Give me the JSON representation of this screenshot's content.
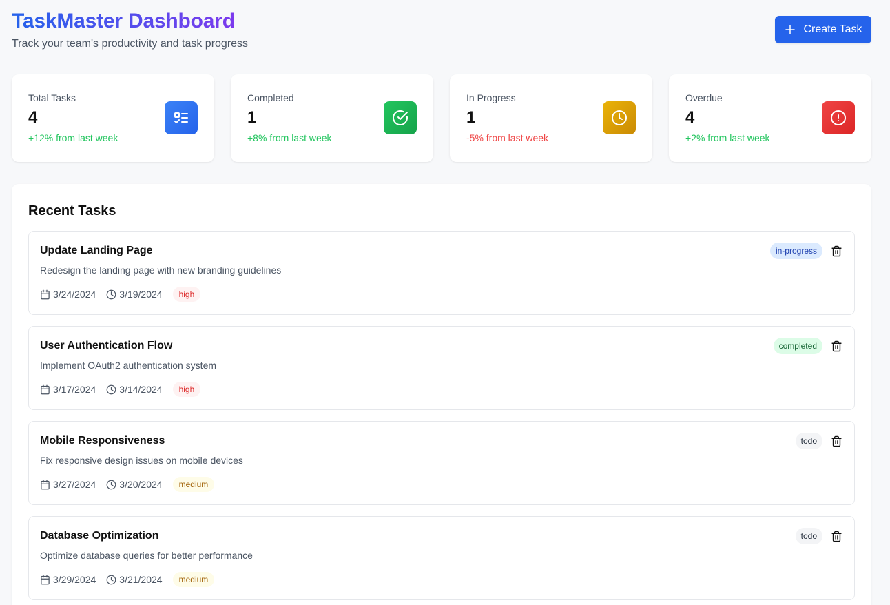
{
  "header": {
    "title": "TaskMaster Dashboard",
    "subtitle": "Track your team's productivity and task progress",
    "create_label": "Create Task"
  },
  "stats": [
    {
      "label": "Total Tasks",
      "value": "4",
      "change": "+12% from last week",
      "trend": "positive",
      "icon": "task-list-icon",
      "color": "#2563eb"
    },
    {
      "label": "Completed",
      "value": "1",
      "change": "+8% from last week",
      "trend": "positive",
      "icon": "check-circle-icon",
      "color": "#16a34a"
    },
    {
      "label": "In Progress",
      "value": "1",
      "change": "-5% from last week",
      "trend": "negative",
      "icon": "clock-icon",
      "color": "#ca8a04"
    },
    {
      "label": "Overdue",
      "value": "4",
      "change": "+2% from last week",
      "trend": "positive",
      "icon": "alert-circle-icon",
      "color": "#dc2626"
    }
  ],
  "recent": {
    "title": "Recent Tasks",
    "tasks": [
      {
        "title": "Update Landing Page",
        "description": "Redesign the landing page with new branding guidelines",
        "due": "3/24/2024",
        "created": "3/19/2024",
        "priority": "high",
        "status": "in-progress"
      },
      {
        "title": "User Authentication Flow",
        "description": "Implement OAuth2 authentication system",
        "due": "3/17/2024",
        "created": "3/14/2024",
        "priority": "high",
        "status": "completed"
      },
      {
        "title": "Mobile Responsiveness",
        "description": "Fix responsive design issues on mobile devices",
        "due": "3/27/2024",
        "created": "3/20/2024",
        "priority": "medium",
        "status": "todo"
      },
      {
        "title": "Database Optimization",
        "description": "Optimize database queries for better performance",
        "due": "3/29/2024",
        "created": "3/21/2024",
        "priority": "medium",
        "status": "todo"
      }
    ]
  },
  "colors": {
    "accent": "#2563eb",
    "title_gradient_start": "#2563eb",
    "title_gradient_end": "#7c3aed",
    "positive": "#22c55e",
    "negative": "#ef4444"
  }
}
